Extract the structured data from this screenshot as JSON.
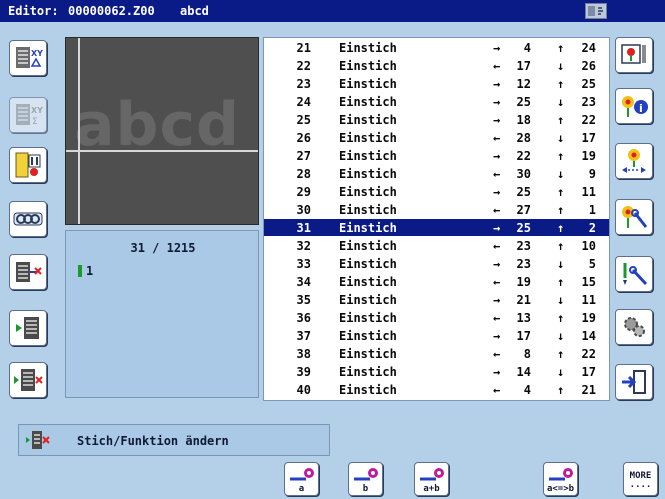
{
  "titlebar": {
    "label": "Editor:",
    "file": "00000062.Z00",
    "design": "abcd"
  },
  "preview": {
    "text": "abcd"
  },
  "info": {
    "counter": "31 / 1215",
    "needle": "1"
  },
  "list": {
    "rows": [
      {
        "n": "21",
        "fn": "Einstich",
        "dx": "→",
        "x": "4",
        "dy": "↑",
        "y": "24"
      },
      {
        "n": "22",
        "fn": "Einstich",
        "dx": "←",
        "x": "17",
        "dy": "↓",
        "y": "26"
      },
      {
        "n": "23",
        "fn": "Einstich",
        "dx": "→",
        "x": "12",
        "dy": "↑",
        "y": "25"
      },
      {
        "n": "24",
        "fn": "Einstich",
        "dx": "→",
        "x": "25",
        "dy": "↓",
        "y": "23"
      },
      {
        "n": "25",
        "fn": "Einstich",
        "dx": "→",
        "x": "18",
        "dy": "↑",
        "y": "22"
      },
      {
        "n": "26",
        "fn": "Einstich",
        "dx": "←",
        "x": "28",
        "dy": "↓",
        "y": "17"
      },
      {
        "n": "27",
        "fn": "Einstich",
        "dx": "→",
        "x": "22",
        "dy": "↑",
        "y": "19"
      },
      {
        "n": "28",
        "fn": "Einstich",
        "dx": "←",
        "x": "30",
        "dy": "↓",
        "y": "9"
      },
      {
        "n": "29",
        "fn": "Einstich",
        "dx": "→",
        "x": "25",
        "dy": "↑",
        "y": "11"
      },
      {
        "n": "30",
        "fn": "Einstich",
        "dx": "←",
        "x": "27",
        "dy": "↑",
        "y": "1"
      },
      {
        "n": "31",
        "fn": "Einstich",
        "dx": "→",
        "x": "25",
        "dy": "↑",
        "y": "2"
      },
      {
        "n": "32",
        "fn": "Einstich",
        "dx": "←",
        "x": "23",
        "dy": "↑",
        "y": "10"
      },
      {
        "n": "33",
        "fn": "Einstich",
        "dx": "→",
        "x": "23",
        "dy": "↓",
        "y": "5"
      },
      {
        "n": "34",
        "fn": "Einstich",
        "dx": "←",
        "x": "19",
        "dy": "↑",
        "y": "15"
      },
      {
        "n": "35",
        "fn": "Einstich",
        "dx": "→",
        "x": "21",
        "dy": "↓",
        "y": "11"
      },
      {
        "n": "36",
        "fn": "Einstich",
        "dx": "←",
        "x": "13",
        "dy": "↑",
        "y": "19"
      },
      {
        "n": "37",
        "fn": "Einstich",
        "dx": "→",
        "x": "17",
        "dy": "↓",
        "y": "14"
      },
      {
        "n": "38",
        "fn": "Einstich",
        "dx": "←",
        "x": "8",
        "dy": "↑",
        "y": "22"
      },
      {
        "n": "39",
        "fn": "Einstich",
        "dx": "→",
        "x": "14",
        "dy": "↓",
        "y": "17"
      },
      {
        "n": "40",
        "fn": "Einstich",
        "dx": "←",
        "x": "4",
        "dy": "↑",
        "y": "21"
      }
    ],
    "selected_number": "31"
  },
  "status": {
    "text": "Stich/Funktion ändern"
  },
  "bottom": {
    "a_label": "a",
    "b_label": "b",
    "ab_label": "a+b",
    "aeqb_label": "a<=>b",
    "more_label": "MORE",
    "more_dots": "...."
  },
  "colors": {
    "titlebar": "#0a1a86",
    "background": "#b4cfe8",
    "selection": "#0a1a86"
  }
}
